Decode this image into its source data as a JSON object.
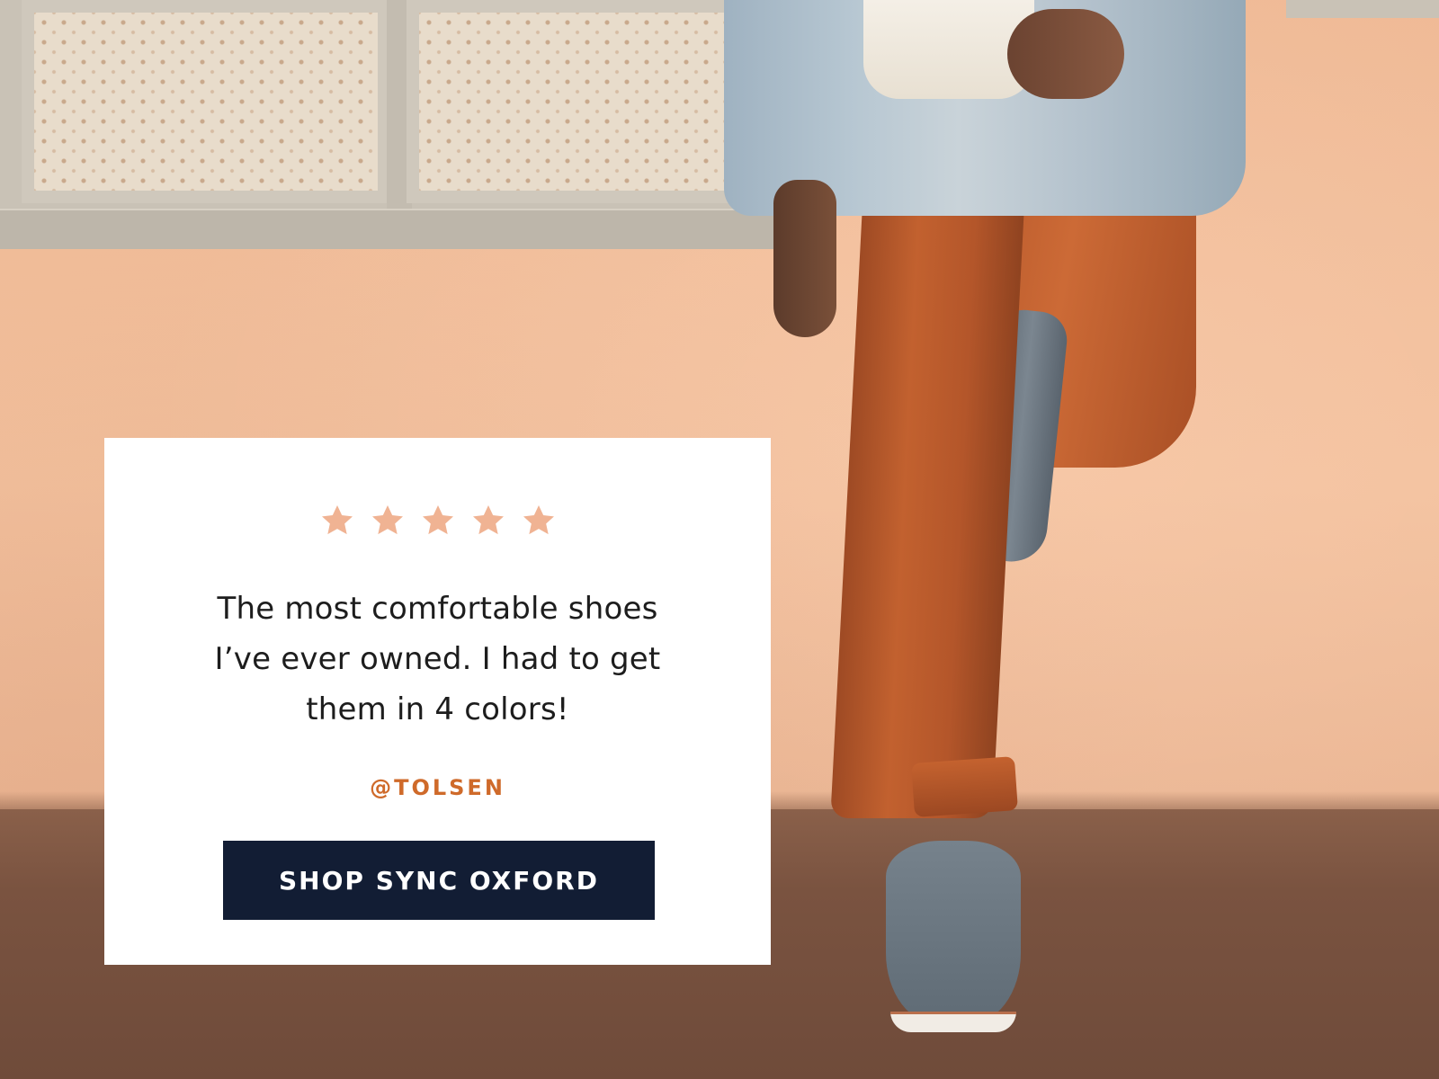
{
  "review": {
    "rating": 5,
    "rating_max": 5,
    "star_color": "#f0b393",
    "quote_line1": "The most comfortable shoes",
    "quote_line2": "I’ve ever owned. I had to get",
    "quote_line3": "them in 4 colors!",
    "author": "@TOLSEN",
    "author_color": "#cf6a2a"
  },
  "cta": {
    "label": "SHOP SYNC OXFORD",
    "background": "#121d34"
  },
  "hero_image": {
    "icon": "lifestyle-photo"
  }
}
